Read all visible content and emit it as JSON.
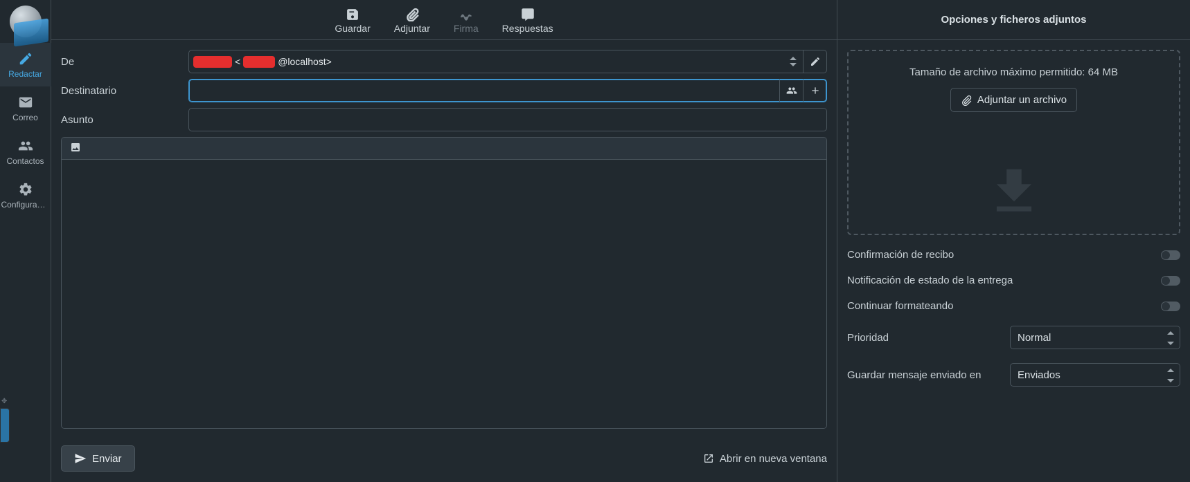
{
  "sidebar": {
    "items": [
      {
        "label": "Redactar"
      },
      {
        "label": "Correo"
      },
      {
        "label": "Contactos"
      },
      {
        "label": "Configuraci…"
      }
    ]
  },
  "toolbar": {
    "save": "Guardar",
    "attach": "Adjuntar",
    "sign": "Firma",
    "resp": "Respuestas"
  },
  "compose": {
    "from_label": "De",
    "from_suffix": "@localhost>",
    "from_bracket": " <",
    "to_label": "Destinatario",
    "subject_label": "Asunto",
    "send": "Enviar",
    "open_new_window": "Abrir en nueva ventana"
  },
  "options_header": "Opciones y ficheros adjuntos",
  "attachments": {
    "max_size_hint": "Tamaño de archivo máximo permitido: 64 MB",
    "attach_file": "Adjuntar un archivo"
  },
  "options": {
    "receipt": "Confirmación de recibo",
    "dsn": "Notificación de estado de la entrega",
    "keep_format": "Continuar formateando",
    "priority_label": "Prioridad",
    "priority_value": "Normal",
    "store_label": "Guardar mensaje enviado en",
    "store_value": "Enviados"
  }
}
